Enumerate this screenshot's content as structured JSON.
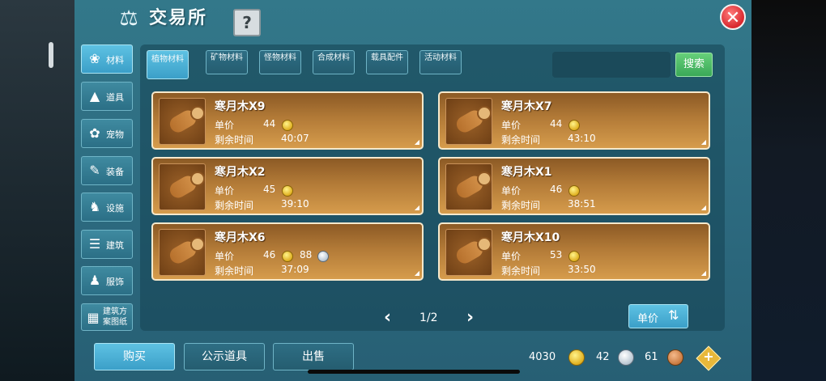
{
  "window": {
    "title": "交易所",
    "help_label": "?",
    "close_label": "✕"
  },
  "sidebar": {
    "items": [
      {
        "label": "材料",
        "icon": "materials-icon",
        "active": true
      },
      {
        "label": "道具",
        "icon": "item-icon"
      },
      {
        "label": "宠物",
        "icon": "paw-icon"
      },
      {
        "label": "装备",
        "icon": "equipment-icon"
      },
      {
        "label": "设施",
        "icon": "facility-icon"
      },
      {
        "label": "建筑",
        "icon": "building-icon"
      },
      {
        "label": "服饰",
        "icon": "clothing-icon"
      },
      {
        "label": "建筑方案图纸",
        "icon": "blueprint-icon"
      }
    ]
  },
  "tabs": [
    {
      "label": "植物材料",
      "active": true
    },
    {
      "label": "矿物材料"
    },
    {
      "label": "怪物材料"
    },
    {
      "label": "合成材料"
    },
    {
      "label": "载具配件"
    },
    {
      "label": "活动材料"
    }
  ],
  "search": {
    "button_label": "搜索",
    "value": ""
  },
  "listings": {
    "price_label": "单价",
    "time_label": "剩余时间",
    "items": [
      {
        "name": "寒月木X9",
        "price_gold": "44",
        "price_silver": "",
        "time": "40:07"
      },
      {
        "name": "寒月木X7",
        "price_gold": "44",
        "price_silver": "",
        "time": "43:10"
      },
      {
        "name": "寒月木X2",
        "price_gold": "45",
        "price_silver": "",
        "time": "39:10"
      },
      {
        "name": "寒月木X1",
        "price_gold": "46",
        "price_silver": "",
        "time": "38:51"
      },
      {
        "name": "寒月木X6",
        "price_gold": "46",
        "price_silver": "88",
        "time": "37:09"
      },
      {
        "name": "寒月木X10",
        "price_gold": "53",
        "price_silver": "",
        "time": "33:50"
      }
    ]
  },
  "pagination": {
    "text": "1/2"
  },
  "sort": {
    "label": "单价"
  },
  "bottom_tabs": [
    {
      "label": "购买",
      "active": true
    },
    {
      "label": "公示道具"
    },
    {
      "label": "出售"
    }
  ],
  "currency": {
    "gold": "4030",
    "silver": "42",
    "copper": "61"
  },
  "colors": {
    "panel": "#2d6b80",
    "card": "#b27a37",
    "accent": "#4bb5dc",
    "search": "#3aa858"
  }
}
